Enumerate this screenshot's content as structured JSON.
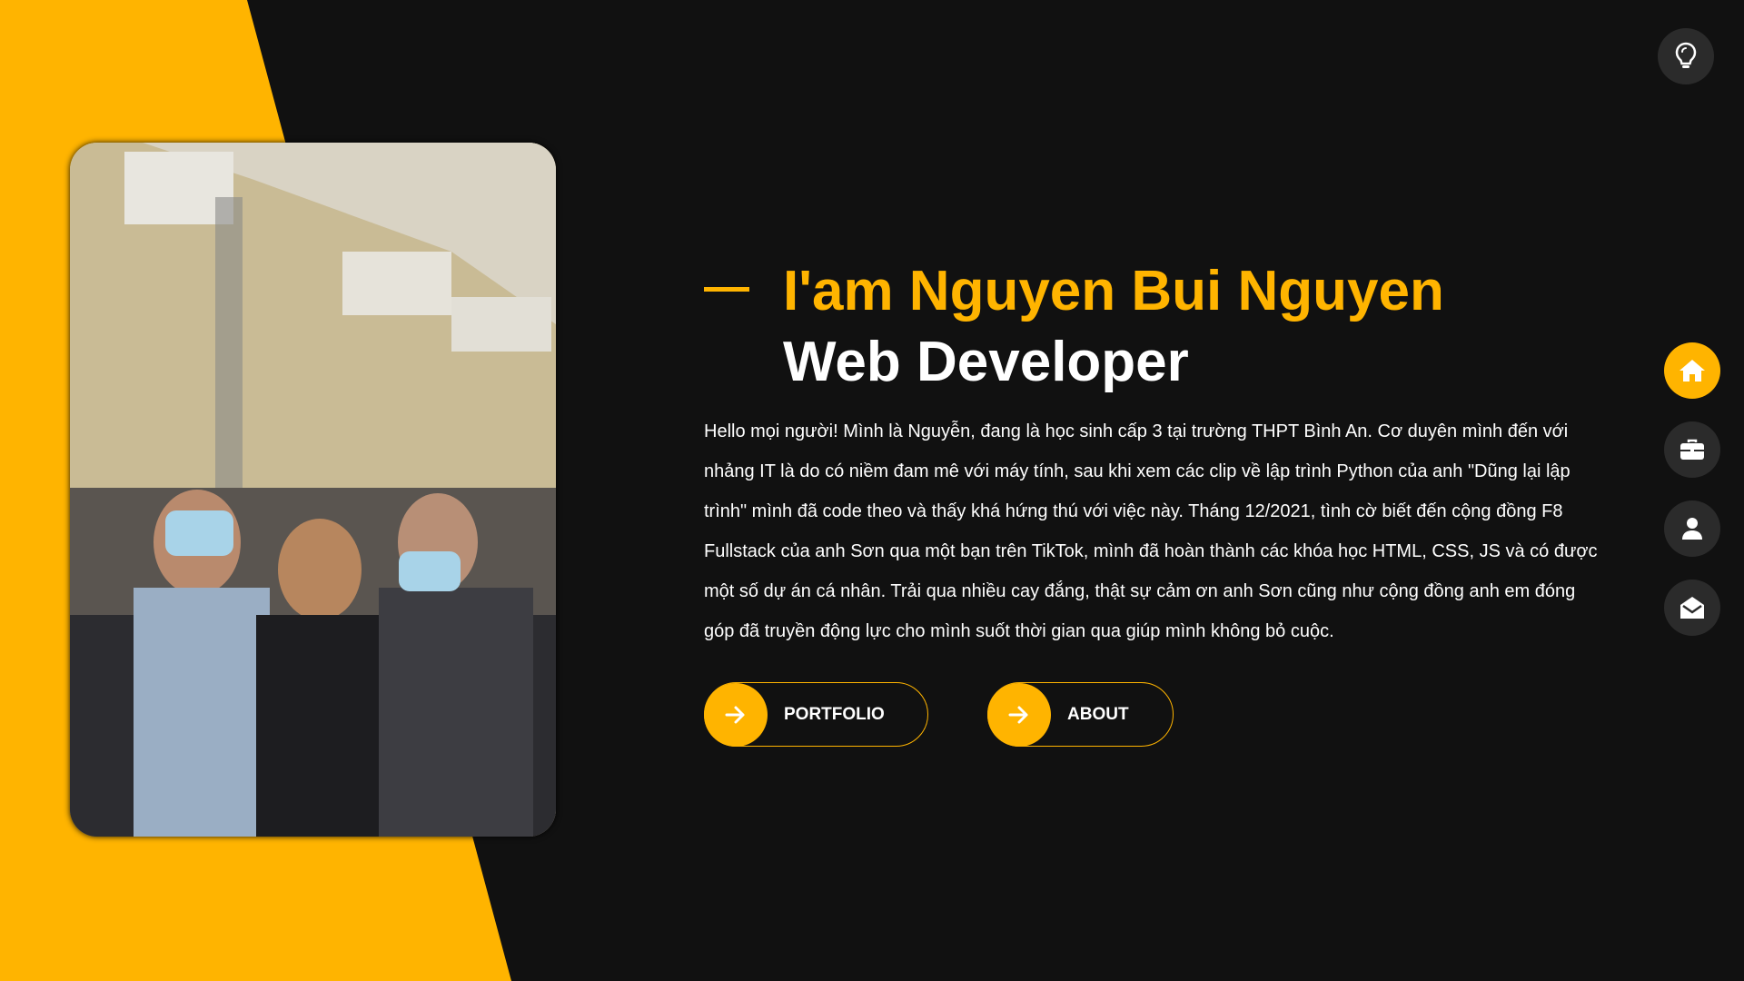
{
  "hero": {
    "name": "I'am Nguyen Bui Nguyen",
    "role": "Web Developer",
    "bio": "Hello mọi người! Mình là Nguyễn, đang là học sinh cấp 3 tại trường THPT Bình An. Cơ duyên mình đến với nhảng IT là do có niềm đam mê với máy tính, sau khi xem các clip về lập trình Python của anh \"Dũng lại lập trình\" mình đã code theo và thấy khá hứng thú với việc này. Tháng 12/2021, tình cờ biết đến cộng đồng F8 Fullstack của anh Sơn qua một bạn trên TikTok, mình đã hoàn thành các khóa học HTML, CSS, JS và có được một số dự án cá nhân. Trải qua nhiều cay đắng, thật sự cảm ơn anh Sơn cũng như cộng đồng anh em đóng góp đã truyền động lực cho mình suốt thời gian qua giúp mình không bỏ cuộc."
  },
  "buttons": {
    "portfolio_label": "PORTFOLIO",
    "about_label": "ABOUT"
  },
  "nav": {
    "items": [
      {
        "name": "home",
        "icon": "home-icon",
        "active": true
      },
      {
        "name": "portfolio",
        "icon": "briefcase-icon",
        "active": false
      },
      {
        "name": "about",
        "icon": "user-icon",
        "active": false
      },
      {
        "name": "contact",
        "icon": "envelope-open-icon",
        "active": false
      }
    ]
  },
  "theme_toggle": {
    "icon": "lightbulb-icon"
  },
  "colors": {
    "accent": "#ffb400",
    "background": "#111111",
    "button_bg": "#2b2b2b",
    "text": "#ffffff"
  }
}
